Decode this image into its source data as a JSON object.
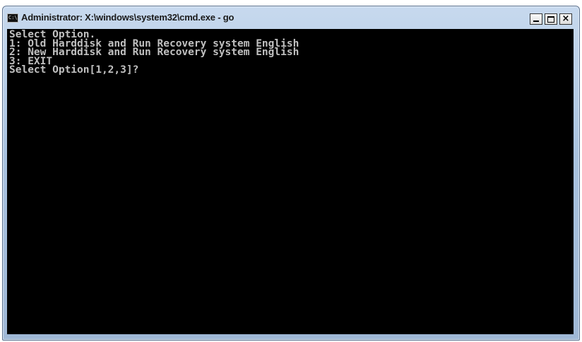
{
  "window": {
    "title": "Administrator: X:\\windows\\system32\\cmd.exe - go",
    "icon": "cmd-icon",
    "icon_text": "C:\\",
    "buttons": {
      "minimize": "minimize-icon",
      "maximize": "maximize-icon",
      "close": "×"
    }
  },
  "console": {
    "lines": [
      "Select Option.",
      "1: Old Harddisk and Run Recovery system English",
      "2: New Harddisk and Run Recovery system English",
      "3: EXIT",
      "Select Option[1,2,3]?"
    ]
  },
  "colors": {
    "console_bg": "#000000",
    "console_fg": "#c0c0c0",
    "frame": "#a9c2df"
  }
}
